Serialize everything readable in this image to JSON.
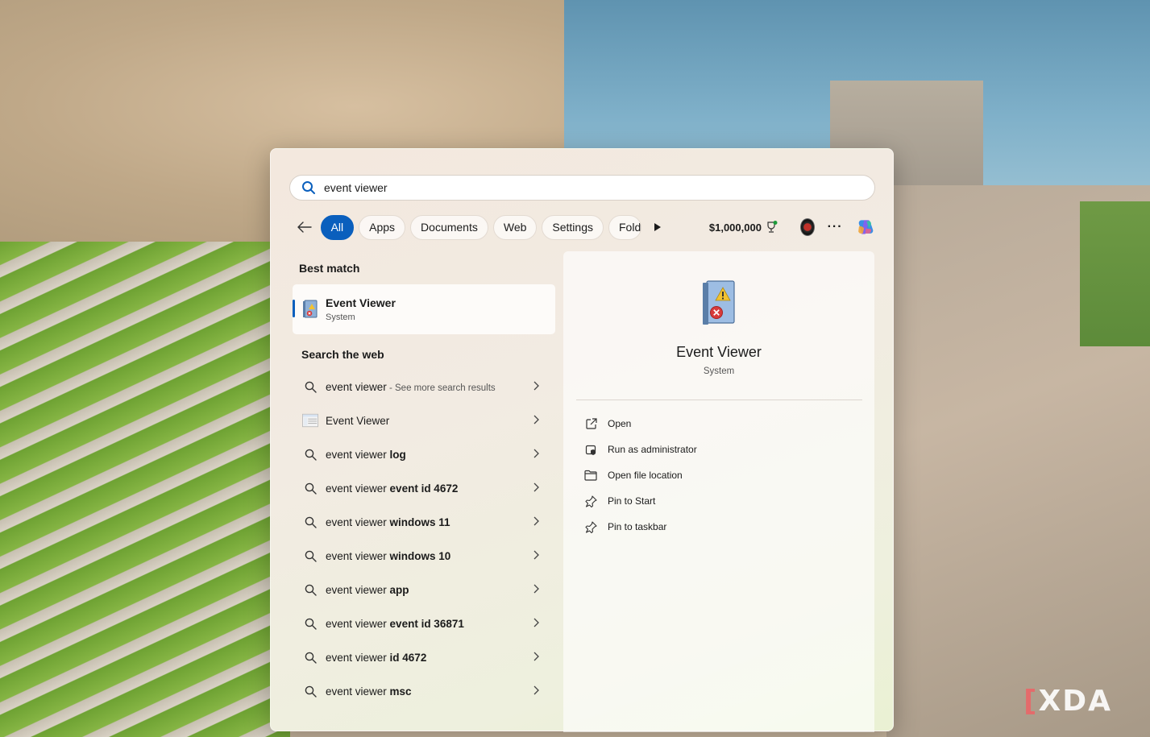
{
  "search": {
    "query": "event viewer"
  },
  "filters": {
    "chips": [
      "All",
      "Apps",
      "Documents",
      "Web",
      "Settings",
      "Folde"
    ],
    "points": "$1,000,000",
    "more": "···"
  },
  "best_match": {
    "title": "Best match",
    "name": "Event Viewer",
    "type": "System"
  },
  "web": {
    "title": "Search the web",
    "items": [
      {
        "prefix": "event viewer",
        "bold": "",
        "extra": " - See more search results",
        "icon": "search-icon"
      },
      {
        "prefix": "Event Viewer",
        "bold": "",
        "extra": "",
        "icon": "event-viewer-thumbnail-icon"
      },
      {
        "prefix": "event viewer ",
        "bold": "log",
        "extra": "",
        "icon": "search-icon"
      },
      {
        "prefix": "event viewer ",
        "bold": "event id 4672",
        "extra": "",
        "icon": "search-icon"
      },
      {
        "prefix": "event viewer ",
        "bold": "windows 11",
        "extra": "",
        "icon": "search-icon"
      },
      {
        "prefix": "event viewer ",
        "bold": "windows 10",
        "extra": "",
        "icon": "search-icon"
      },
      {
        "prefix": "event viewer ",
        "bold": "app",
        "extra": "",
        "icon": "search-icon"
      },
      {
        "prefix": "event viewer ",
        "bold": "event id 36871",
        "extra": "",
        "icon": "search-icon"
      },
      {
        "prefix": "event viewer ",
        "bold": "id 4672",
        "extra": "",
        "icon": "search-icon"
      },
      {
        "prefix": "event viewer ",
        "bold": "msc",
        "extra": "",
        "icon": "search-icon"
      }
    ]
  },
  "preview": {
    "name": "Event Viewer",
    "type": "System",
    "actions": [
      {
        "label": "Open",
        "icon": "open-external-icon"
      },
      {
        "label": "Run as administrator",
        "icon": "shield-admin-icon"
      },
      {
        "label": "Open file location",
        "icon": "folder-icon"
      },
      {
        "label": "Pin to Start",
        "icon": "pin-icon"
      },
      {
        "label": "Pin to taskbar",
        "icon": "pin-icon"
      }
    ]
  },
  "watermark": "XDA",
  "colors": {
    "accent": "#0a5fbd"
  }
}
